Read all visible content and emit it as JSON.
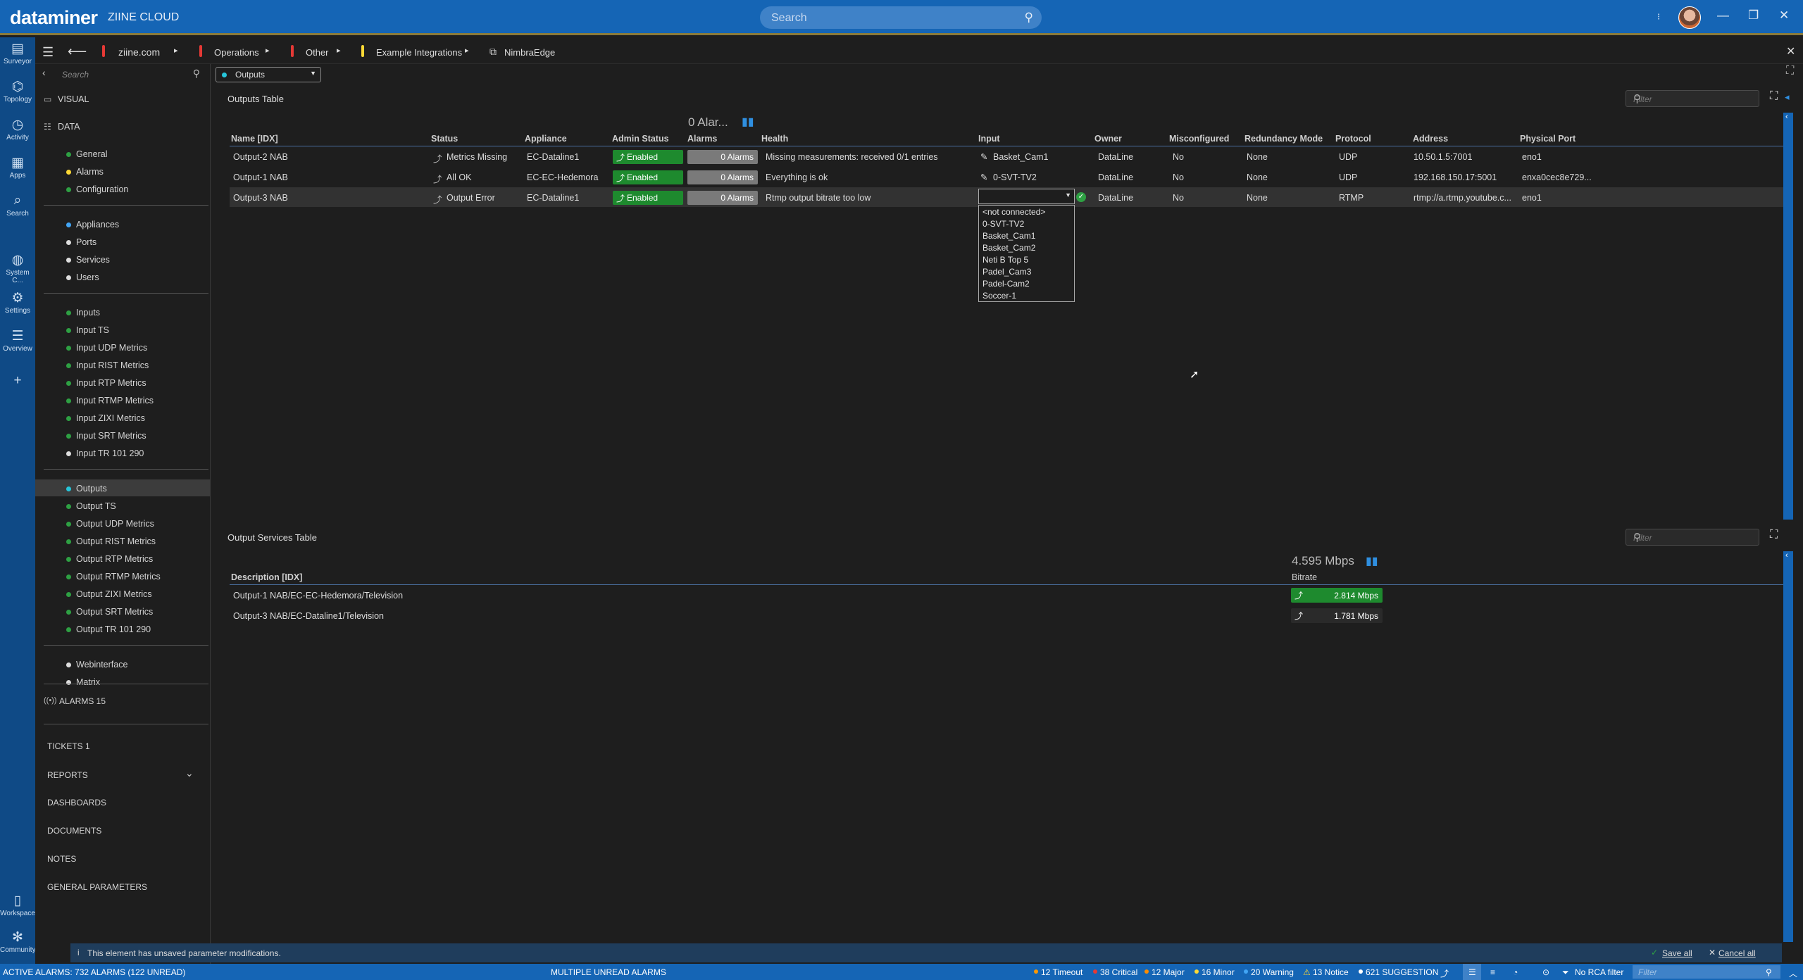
{
  "app": {
    "logo": "dataminer",
    "system_name": "ZIINE CLOUD",
    "search_placeholder": "Search"
  },
  "rail": [
    {
      "label": "Surveyor",
      "icon": "surveyor-icon",
      "glyph": "▤"
    },
    {
      "label": "Topology",
      "icon": "topology-icon",
      "glyph": "⌬"
    },
    {
      "label": "Activity",
      "icon": "activity-icon",
      "glyph": "◷"
    },
    {
      "label": "Apps",
      "icon": "apps-icon",
      "glyph": "▦"
    },
    {
      "label": "Search",
      "icon": "search-icon",
      "glyph": "⌕"
    },
    {
      "label": "System C...",
      "icon": "globe-icon",
      "glyph": "◍"
    },
    {
      "label": "Settings",
      "icon": "gear-icon",
      "glyph": "⚙"
    },
    {
      "label": "Overview",
      "icon": "overview-icon",
      "glyph": "☰"
    },
    {
      "label": "",
      "icon": "plus-icon",
      "glyph": "+"
    },
    {
      "label": "Workspace",
      "icon": "workspace-icon",
      "glyph": "▯"
    },
    {
      "label": "Community",
      "icon": "community-icon",
      "glyph": "✻"
    }
  ],
  "breadcrumb": {
    "items": [
      "ziine.com",
      "Operations",
      "Other",
      "Example Integrations",
      "NimbraEdge"
    ]
  },
  "sidenav": {
    "search_placeholder": "Search",
    "visual": "VISUAL",
    "data": "DATA",
    "groups": [
      [
        "General",
        "Alarms",
        "Configuration"
      ],
      [
        "Appliances",
        "Ports",
        "Services",
        "Users"
      ],
      [
        "Inputs",
        "Input TS",
        "Input UDP Metrics",
        "Input RIST Metrics",
        "Input RTP Metrics",
        "Input RTMP Metrics",
        "Input ZIXI Metrics",
        "Input SRT Metrics",
        "Input TR 101 290"
      ],
      [
        "Outputs",
        "Output TS",
        "Output UDP Metrics",
        "Output RIST Metrics",
        "Output RTP Metrics",
        "Output RTMP Metrics",
        "Output ZIXI Metrics",
        "Output SRT Metrics",
        "Output TR 101 290"
      ],
      [
        "Webinterface",
        "Matrix"
      ]
    ],
    "alarms": "ALARMS 15",
    "tickets": "TICKETS 1",
    "reports": "REPORTS",
    "dashboards": "DASHBOARDS",
    "documents": "DOCUMENTS",
    "notes": "NOTES",
    "general_parameters": "GENERAL PARAMETERS"
  },
  "page_select": "Outputs",
  "outputs_table": {
    "title": "Outputs Table",
    "filter_placeholder": "Filter",
    "alarm_summary": "0 Alar...",
    "columns": [
      "Name [IDX]",
      "Status",
      "Appliance",
      "Admin Status",
      "Alarms",
      "Health",
      "Input",
      "Owner",
      "Misconfigured",
      "Redundancy Mode",
      "Protocol",
      "Address",
      "Physical Port"
    ],
    "rows": [
      {
        "name": "Output-2 NAB",
        "status": "Metrics Missing",
        "appliance": "EC-Dataline1",
        "admin": "Enabled",
        "alarms": "0 Alarms",
        "health": "Missing measurements: received 0/1 entries",
        "input": "Basket_Cam1",
        "owner": "DataLine",
        "misconfigured": "No",
        "redundancy": "None",
        "protocol": "UDP",
        "address": "10.50.1.5:7001",
        "port": "eno1"
      },
      {
        "name": "Output-1 NAB",
        "status": "All OK",
        "appliance": "EC-EC-Hedemora",
        "admin": "Enabled",
        "alarms": "0 Alarms",
        "health": "Everything is ok",
        "input": "0-SVT-TV2",
        "owner": "DataLine",
        "misconfigured": "No",
        "redundancy": "None",
        "protocol": "UDP",
        "address": "192.168.150.17:5001",
        "port": "enxa0cec8e729..."
      },
      {
        "name": "Output-3 NAB",
        "status": "Output Error",
        "appliance": "EC-Dataline1",
        "admin": "Enabled",
        "alarms": "0 Alarms",
        "health": "Rtmp output bitrate too low",
        "input": "",
        "owner": "DataLine",
        "misconfigured": "No",
        "redundancy": "None",
        "protocol": "RTMP",
        "address": "rtmp://a.rtmp.youtube.c...",
        "port": "eno1"
      }
    ],
    "input_options": [
      "<not connected>",
      "0-SVT-TV2",
      "Basket_Cam1",
      "Basket_Cam2",
      "Neti B Top 5",
      "Padel_Cam3",
      "Padel-Cam2",
      "Soccer-1"
    ]
  },
  "services_table": {
    "title": "Output Services Table",
    "filter_placeholder": "Filter",
    "bitrate_summary": "4.595 Mbps",
    "columns": [
      "Description [IDX]",
      "Bitrate"
    ],
    "rows": [
      {
        "description": "Output-1 NAB/EC-EC-Hedemora/Television",
        "bitrate": "2.814 Mbps",
        "bitrate_fill": "green"
      },
      {
        "description": "Output-3 NAB/EC-Dataline1/Television",
        "bitrate": "1.781 Mbps",
        "bitrate_fill": "dark"
      }
    ]
  },
  "message_bar": {
    "text": "This element has unsaved parameter modifications.",
    "save": "Save all",
    "cancel": "Cancel all"
  },
  "statusbar": {
    "active_alarms": "ACTIVE ALARMS: 732 ALARMS (122 UNREAD)",
    "multiple": "MULTIPLE UNREAD ALARMS",
    "timeout": "12 Timeout",
    "critical": "38 Critical",
    "major": "12 Major",
    "minor": "16 Minor",
    "warning": "20 Warning",
    "notice": "13 Notice",
    "suggestion": "621 SUGGESTION",
    "rca": "No RCA filter",
    "filter_placeholder": "Filter"
  },
  "colors": {
    "brand": "#1565b5",
    "enabled": "#1e8a2e",
    "critical": "#e53935",
    "major": "#fb8c00",
    "minor": "#fdd835",
    "warning": "#42a5f5",
    "timeout": "#ff9800"
  }
}
